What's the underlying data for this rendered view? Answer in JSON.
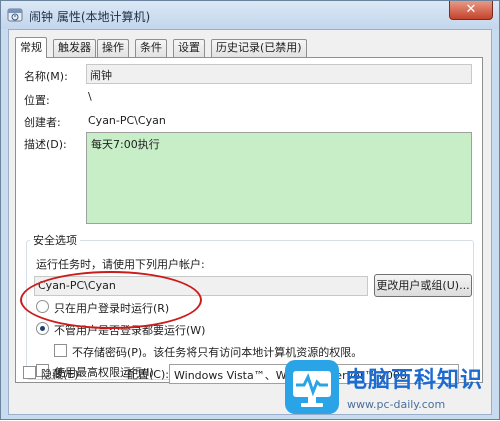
{
  "window": {
    "title": "闹钟 属性(本地计算机)",
    "close_label": "✕"
  },
  "tabs": [
    {
      "label": "常规",
      "active": true
    },
    {
      "label": "触发器"
    },
    {
      "label": "操作"
    },
    {
      "label": "条件"
    },
    {
      "label": "设置"
    },
    {
      "label": "历史记录(已禁用)"
    }
  ],
  "general": {
    "name_label": "名称(M):",
    "name_value": "闹钟",
    "location_label": "位置:",
    "location_value": "\\",
    "author_label": "创建者:",
    "author_value": "Cyan-PC\\Cyan",
    "description_label": "描述(D):",
    "description_value": "每天7:00执行"
  },
  "security": {
    "group_title": "安全选项",
    "run_as_prompt": "运行任务时，请使用下列用户帐户:",
    "account_value": "Cyan-PC\\Cyan",
    "change_user_button": "更改用户或组(U)...",
    "radio_logged_on": "只在用户登录时运行(R)",
    "radio_whether_logged_on": "不管用户是否登录都要运行(W)",
    "do_not_store_password": "不存储密码(P)。该任务将只有访问本地计算机资源的权限。",
    "run_highest_privileges": "使用最高权限运行(I)"
  },
  "footer": {
    "hidden_label": "隐藏(E)",
    "configure_label": "配置(C):",
    "configure_value": "Windows Vista™、Windows Server™ 2008"
  },
  "watermark": {
    "title": "电脑百科知识",
    "url": "www.pc-daily.com"
  },
  "colors": {
    "accent_red": "#cc1b1b",
    "description_bg": "#c8eec8",
    "watermark_blue": "#1e6bd0"
  }
}
